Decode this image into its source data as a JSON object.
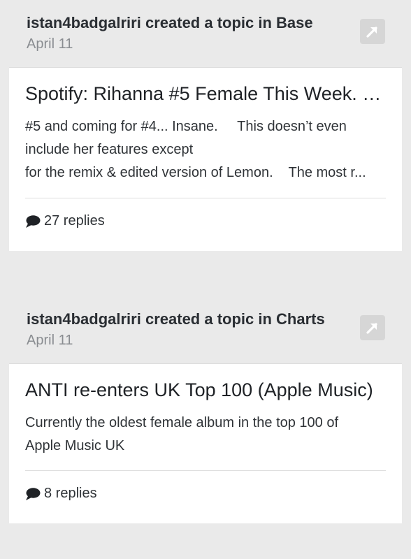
{
  "activities": [
    {
      "author": "istan4badgalriri",
      "action": "created a topic in",
      "forum": "Base",
      "date": "April 11",
      "title": "Spotify: Rihanna #5 Female This Week. …",
      "snippet_lines": [
        "#5 and coming for #4... Insane.     This doesn’t even",
        "include her features except",
        "for the remix & edited version of Lemon.    The most r..."
      ],
      "replies": "27 replies"
    },
    {
      "author": "istan4badgalriri",
      "action": "created a topic in",
      "forum": "Charts",
      "date": "April 11",
      "title": "ANTI re-enters UK Top 100 (Apple Music)",
      "snippet_lines": [
        "Currently the oldest female album in the top 100 of",
        "Apple Music UK"
      ],
      "replies": "8 replies"
    }
  ],
  "icons": {
    "share": "share-arrow-icon",
    "replies": "speech-bubble-icon"
  },
  "colors": {
    "background": "#eaeaea",
    "card": "#ffffff",
    "share_button": "#d6d6d6"
  }
}
